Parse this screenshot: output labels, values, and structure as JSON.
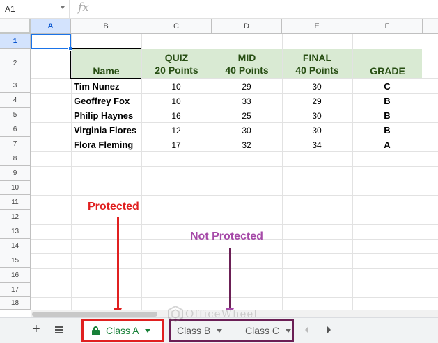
{
  "formula_bar": {
    "name_box": "A1",
    "fx_label": "fx"
  },
  "columns": [
    "A",
    "B",
    "C",
    "D",
    "E",
    "F"
  ],
  "rows": [
    "1",
    "2",
    "3",
    "4",
    "5",
    "6",
    "7",
    "8",
    "9",
    "10",
    "11",
    "12",
    "13",
    "14",
    "15",
    "16",
    "17",
    "18"
  ],
  "table": {
    "headers": {
      "name": "Name",
      "quiz_1": "QUIZ",
      "quiz_2": "20 Points",
      "mid_1": "MID",
      "mid_2": "40 Points",
      "final_1": "FINAL",
      "final_2": "40 Points",
      "grade": "GRADE"
    },
    "students": [
      {
        "name": "Tim Nunez",
        "quiz": "10",
        "mid": "29",
        "final": "30",
        "grade": "C"
      },
      {
        "name": "Geoffrey Fox",
        "quiz": "10",
        "mid": "33",
        "final": "29",
        "grade": "B"
      },
      {
        "name": "Philip Haynes",
        "quiz": "16",
        "mid": "25",
        "final": "30",
        "grade": "B"
      },
      {
        "name": "Virginia Flores",
        "quiz": "12",
        "mid": "30",
        "final": "30",
        "grade": "B"
      },
      {
        "name": "Flora Fleming",
        "quiz": "17",
        "mid": "32",
        "final": "34",
        "grade": "A"
      }
    ]
  },
  "annotations": {
    "protected": "Protected",
    "not_protected": "Not Protected"
  },
  "watermark": "OfficeWheel",
  "sheet_tabs": [
    {
      "label": "Class A",
      "protected": true,
      "active": true
    },
    {
      "label": "Class B",
      "protected": false,
      "active": false
    },
    {
      "label": "Class C",
      "protected": false,
      "active": false
    }
  ],
  "colors": {
    "header_band": "#d9ead3",
    "header_text": "#274e13",
    "protected_outline": "#e02020",
    "unprotected_outline": "#6b1f55",
    "active_tab_text": "#188038",
    "selection": "#1a73e8"
  },
  "icons": {
    "add_sheet": "plus-icon",
    "all_sheets": "list-icon",
    "lock": "lock-icon"
  }
}
